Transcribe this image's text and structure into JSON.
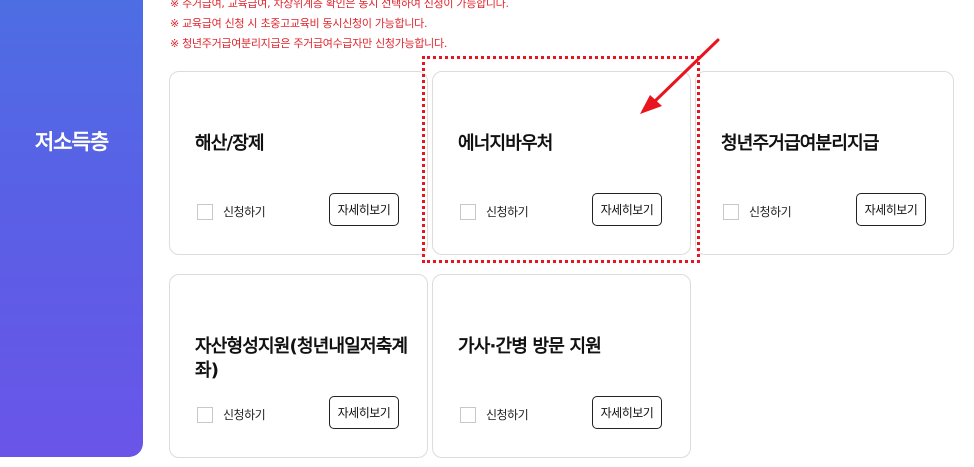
{
  "sidebar": {
    "title": "저소득층"
  },
  "notes": [
    "※ 주거급여, 교육급여, 차상위계층 확인은 동시 선택하여 신청이 가능합니다.",
    "※ 교육급여 신청 시 초중고교육비 동시신청이 가능합니다.",
    "※ 청년주거급여분리지급은 주거급여수급자만 신청가능합니다."
  ],
  "cards": [
    {
      "title": "해산/장제",
      "apply_label": "신청하기",
      "detail_label": "자세히보기"
    },
    {
      "title": "에너지바우처",
      "apply_label": "신청하기",
      "detail_label": "자세히보기"
    },
    {
      "title": "청년주거급여분리지급",
      "apply_label": "신청하기",
      "detail_label": "자세히보기"
    },
    {
      "title": "자산형성지원(청년내일저축계좌)",
      "apply_label": "신청하기",
      "detail_label": "자세히보기"
    },
    {
      "title": "가사·간병 방문 지원",
      "apply_label": "신청하기",
      "detail_label": "자세히보기"
    }
  ],
  "annotation": {
    "color": "#e8141e"
  },
  "colors": {
    "sidebar_gradient_start": "#4c6fe3",
    "sidebar_gradient_end": "#6a55e8",
    "note_text": "#e0262e"
  }
}
